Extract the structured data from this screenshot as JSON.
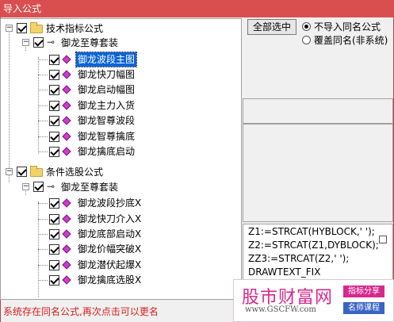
{
  "window": {
    "title": "导入公式"
  },
  "tree": [
    {
      "label": "技术指标公式",
      "kind": "folder"
    },
    {
      "label": "御龙至尊套装",
      "kind": "set"
    },
    {
      "label": "御龙波段主图",
      "kind": "formula",
      "selected": true
    },
    {
      "label": "御龙快刀幅图",
      "kind": "formula"
    },
    {
      "label": "御龙启动幅图",
      "kind": "formula"
    },
    {
      "label": "御龙主力入货",
      "kind": "formula"
    },
    {
      "label": "御龙智尊波段",
      "kind": "formula"
    },
    {
      "label": "御龙智尊擒底",
      "kind": "formula"
    },
    {
      "label": "御龙擒底启动",
      "kind": "formula"
    },
    {
      "label": "条件选股公式",
      "kind": "folder"
    },
    {
      "label": "御龙至尊套装",
      "kind": "set"
    },
    {
      "label": "御龙波段抄底X",
      "kind": "formula"
    },
    {
      "label": "御龙快刀介入X",
      "kind": "formula"
    },
    {
      "label": "御龙底部启动X",
      "kind": "formula"
    },
    {
      "label": "御龙价幅突破X",
      "kind": "formula"
    },
    {
      "label": "御龙潜伏起爆X",
      "kind": "formula"
    },
    {
      "label": "御龙擒底选股X",
      "kind": "formula"
    }
  ],
  "buttons": {
    "select_all": "全部选中"
  },
  "options": {
    "no_import": "不导入同名公式",
    "overwrite": "覆盖同名(非系统)",
    "selected": "no_import"
  },
  "code_lines": [
    "Z1:=STRCAT(HYBLOCK,' ');",
    "Z2:=STRCAT(Z1,DYBLOCK);",
    "ZZ3:=STRCAT(Z2,' ');",
    "DRAWTEXT_FIX"
  ],
  "status": "系统存在同名公式,再次点击可以更名",
  "watermark": {
    "name": "股市财富网",
    "url": "www.GSCFW.com",
    "tag1": "指标分享",
    "tag2": "名师课程"
  },
  "colors": {
    "title_bar": "#d94f4f",
    "selection": "#0a64d8",
    "status_text": "#d81e1e"
  }
}
